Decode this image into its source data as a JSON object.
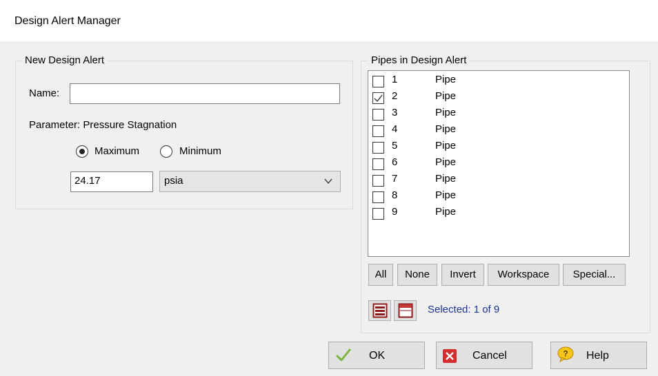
{
  "window": {
    "title": "Design Alert Manager"
  },
  "new_alert": {
    "group_label": "New Design Alert",
    "name_label": "Name:",
    "name_value": "",
    "parameter_label": "Parameter: Pressure Stagnation",
    "radio_maximum_label": "Maximum",
    "radio_minimum_label": "Minimum",
    "selected_radio": "Maximum",
    "value": "24.17",
    "unit": "psia"
  },
  "pipes": {
    "group_label": "Pipes in Design Alert",
    "items": [
      {
        "number": "1",
        "type": "Pipe",
        "checked": false
      },
      {
        "number": "2",
        "type": "Pipe",
        "checked": true
      },
      {
        "number": "3",
        "type": "Pipe",
        "checked": false
      },
      {
        "number": "4",
        "type": "Pipe",
        "checked": false
      },
      {
        "number": "5",
        "type": "Pipe",
        "checked": false
      },
      {
        "number": "6",
        "type": "Pipe",
        "checked": false
      },
      {
        "number": "7",
        "type": "Pipe",
        "checked": false
      },
      {
        "number": "8",
        "type": "Pipe",
        "checked": false
      },
      {
        "number": "9",
        "type": "Pipe",
        "checked": false
      }
    ],
    "buttons": {
      "all": "All",
      "none": "None",
      "invert": "Invert",
      "workspace": "Workspace",
      "special": "Special..."
    },
    "selected_text": "Selected: 1 of 9"
  },
  "footer": {
    "ok": "OK",
    "cancel": "Cancel",
    "help": "Help"
  },
  "colors": {
    "checkmark": "#333333",
    "ok_check": "#7cb342",
    "cancel_red": "#d32f2f",
    "help_yellow": "#f5c518",
    "selected_text": "#1a3399",
    "list_icon_red": "#8b1a1a"
  },
  "icons": {
    "ok": "green-checkmark-icon",
    "cancel": "red-x-icon",
    "help": "question-bubble-icon",
    "list_view_1": "list-rows-icon",
    "list_view_2": "list-header-icon"
  }
}
